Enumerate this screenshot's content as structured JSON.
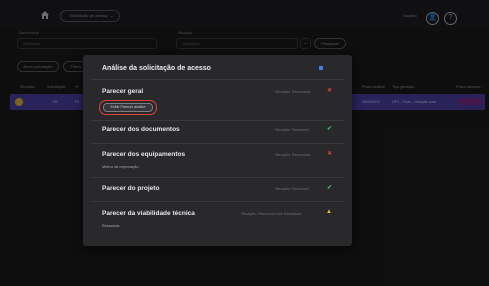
{
  "header": {
    "breadcrumb": "Solicitação de acesso",
    "user_name": "Usuário",
    "avatar_glyph": "👤",
    "help_glyph": "?"
  },
  "filters": {
    "label_primary": "Distribuidora",
    "label_secondary": "Situação",
    "input_primary_placeholder": "Selecione",
    "input_secondary_placeholder": "Selecione",
    "search_button": "Pesquisar",
    "new_request_button": "Nova solicitação",
    "second_button": "Filtros"
  },
  "table": {
    "headers": [
      "Situação",
      "Solicitação",
      "Pr",
      "Prazo análise",
      "Tipo geração",
      "Prazo adequa..."
    ],
    "row": {
      "col1": "",
      "col2": "132",
      "col3": "Fil",
      "prazo": "05/06/2023",
      "tipo": "UFV - Solar - Geração solar",
      "badge": ""
    }
  },
  "modal": {
    "title": "Análise da solicitação de acesso",
    "sections": [
      {
        "title": "Parecer geral",
        "status": "Situação: Reprovada",
        "status_kind": "x",
        "button": "Exibir Parecer análise",
        "sub": ""
      },
      {
        "title": "Parecer dos documentos",
        "status": "Situação: Favorável",
        "status_kind": "check",
        "sub": ""
      },
      {
        "title": "Parecer dos equipamentos",
        "status": "Situação: Reprovada",
        "status_kind": "x",
        "sub": "Motivo de reprovação"
      },
      {
        "title": "Parecer do projeto",
        "status": "Situação: Favorável",
        "status_kind": "check",
        "sub": ""
      },
      {
        "title": "Parecer da viabilidade técnica",
        "status": "Situação: Favorável com Ressalvas",
        "status_kind": "warn",
        "sub": "Ressalvas"
      }
    ]
  },
  "colors": {
    "accent_row": "#4b3fa6",
    "status_reproved": "#e0443a",
    "status_ok": "#3fbf5a",
    "status_warn": "#e6c133"
  }
}
